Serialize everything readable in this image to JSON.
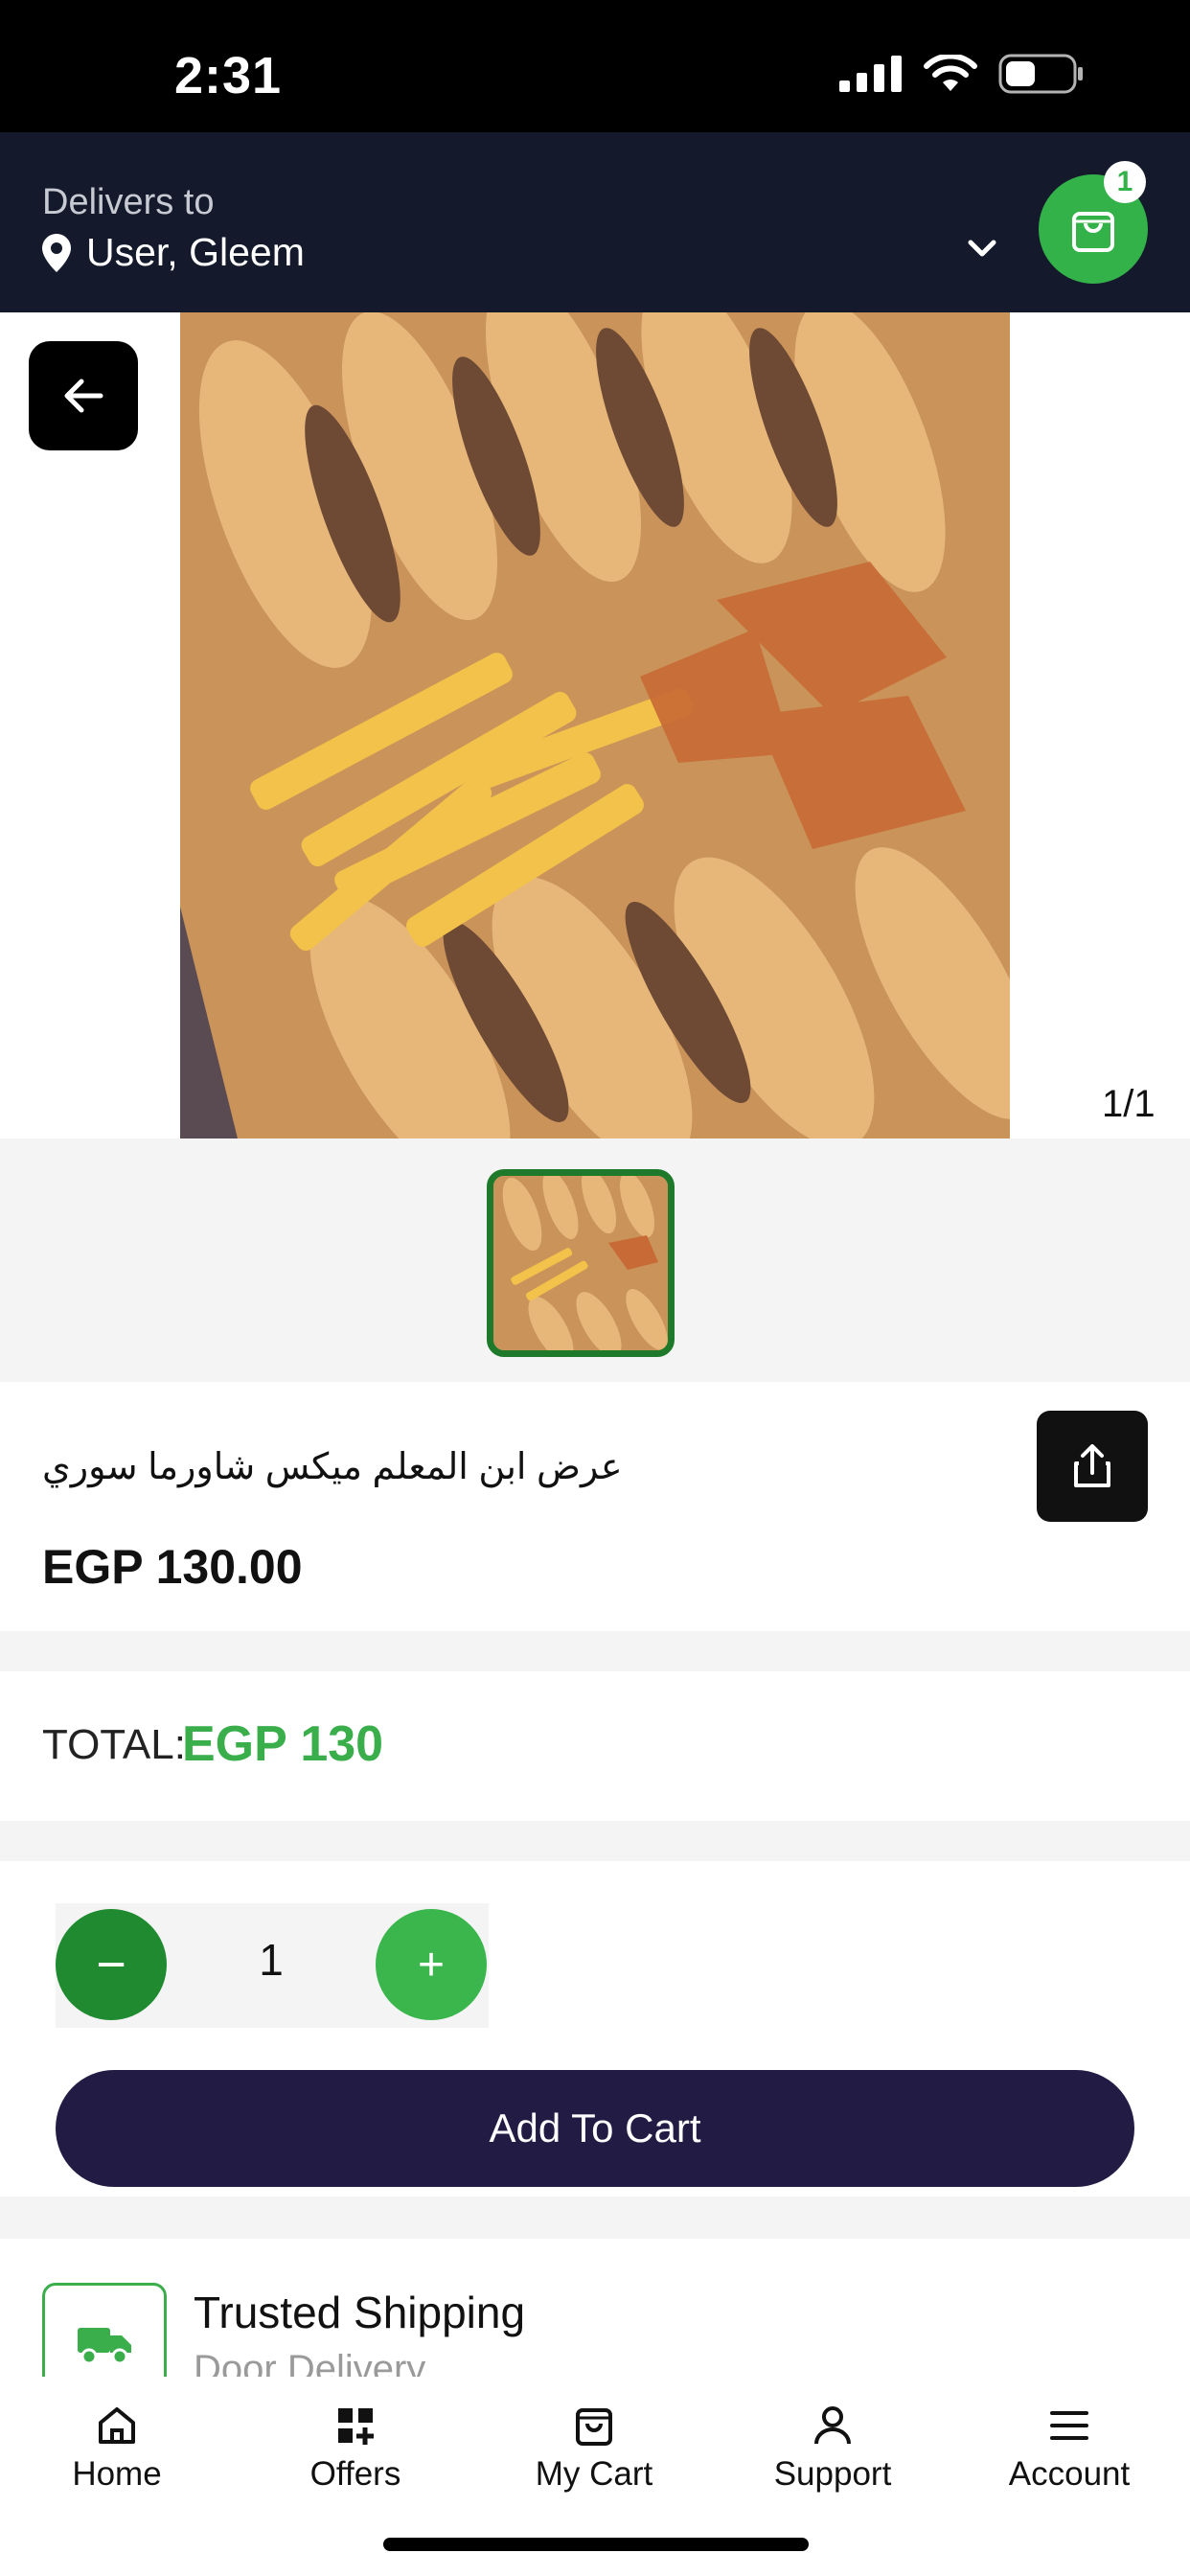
{
  "status_bar": {
    "time": "2:31"
  },
  "header": {
    "delivers_label": "Delivers to",
    "location": "User, Gleem",
    "cart_badge": "1"
  },
  "gallery": {
    "counter": "1/1"
  },
  "product": {
    "name": "عرض ابن المعلم ميكس شاورما سوري",
    "price": "EGP 130.00"
  },
  "total": {
    "label": "TOTAL:",
    "value": "EGP 130"
  },
  "quantity": {
    "value": "1",
    "minus": "−",
    "plus": "+"
  },
  "actions": {
    "add_to_cart": "Add To Cart"
  },
  "shipping": {
    "title": "Trusted Shipping",
    "subtitle": "Door Delivery"
  },
  "bottom_nav": {
    "home": "Home",
    "offers": "Offers",
    "cart": "My Cart",
    "support": "Support",
    "account": "Account"
  },
  "colors": {
    "brand_green": "#34b24a",
    "header_dark": "#141a2b",
    "button_navy": "#221c44"
  }
}
